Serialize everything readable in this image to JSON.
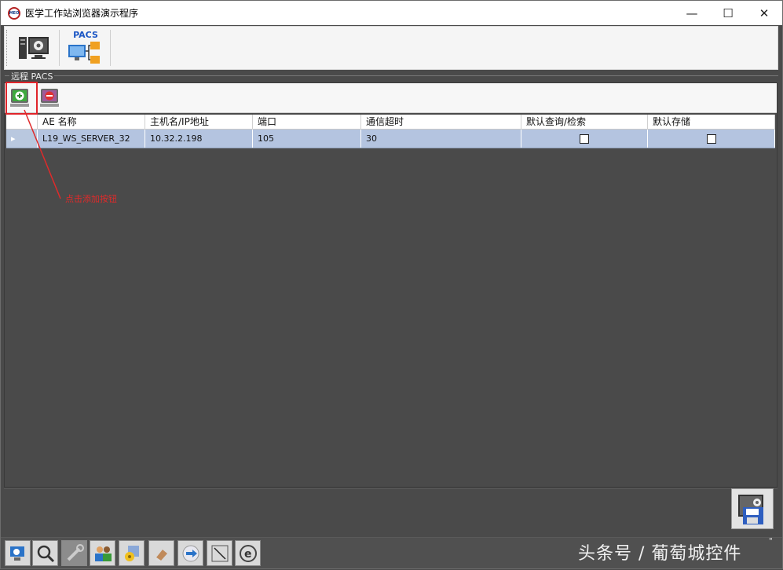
{
  "window": {
    "title": "医学工作站浏览器演示程序",
    "logo_text": "MEO",
    "minimize": "—",
    "maximize": "☐",
    "close": "✕"
  },
  "toolbar": {
    "pacs_label": "PACS"
  },
  "group": {
    "label": "远程 PACS"
  },
  "table": {
    "headers": [
      "",
      "AE 名称",
      "主机名/IP地址",
      "端口",
      "通信超时",
      "默认查询/检索",
      "默认存储"
    ],
    "rows": [
      {
        "marker": "▸",
        "ae_name": "L19_WS_SERVER_32",
        "host": "10.32.2.198",
        "port": "105",
        "timeout": "30",
        "default_query": false,
        "default_store": false
      }
    ]
  },
  "annotation": {
    "text": "点击添加按钮",
    "color": "#e02a2a"
  },
  "watermark": "头条号 / 葡萄城控件",
  "corner_mark": "\""
}
